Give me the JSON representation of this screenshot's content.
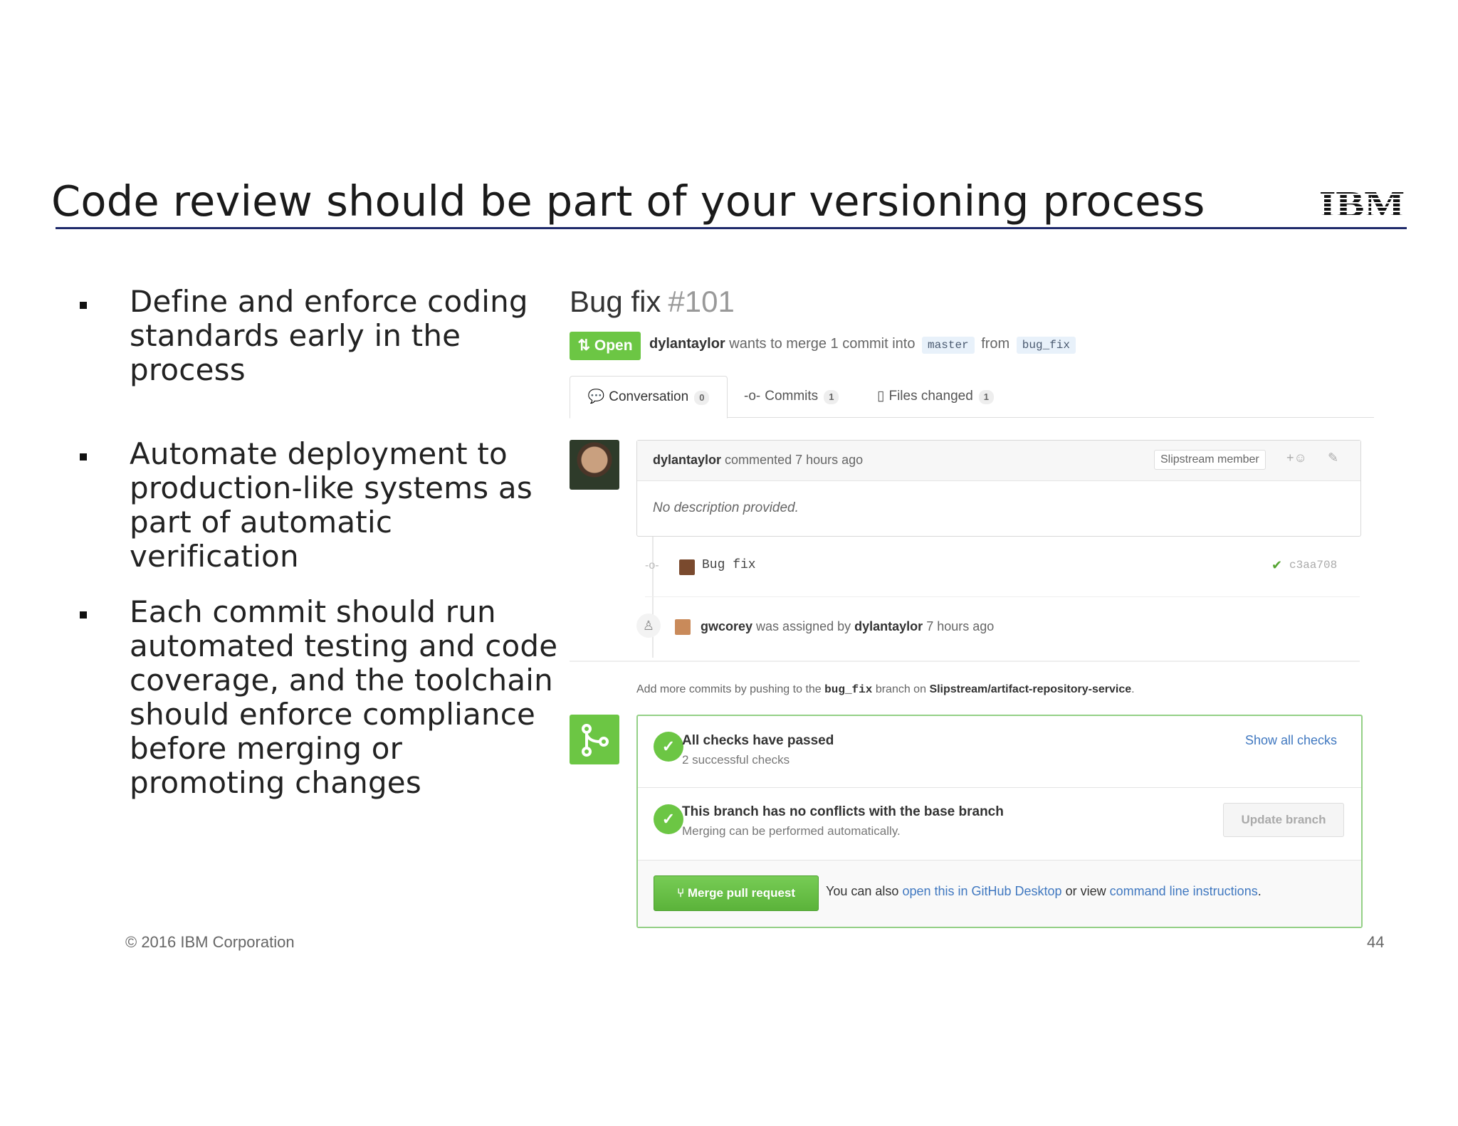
{
  "slide": {
    "title": "Code review should be part of your versioning process",
    "logo_text": "IBM",
    "footer": "© 2016 IBM Corporation",
    "page_number": "44"
  },
  "bullets": [
    "Define and enforce coding standards early in the process",
    "Automate deployment  to production-like  systems  as part of automatic  verification",
    "Each commit should  run automated  testing and code coverage, and the toolchain should  enforce compliance before merging or promoting changes"
  ],
  "pull_request": {
    "title": "Bug fix",
    "number": "#101",
    "state": "Open",
    "author": "dylantaylor",
    "merge_text": "wants to merge 1 commit into",
    "base_branch": "master",
    "from_text": "from",
    "head_branch": "bug_fix",
    "tabs": [
      {
        "label": "Conversation",
        "count": "0",
        "icon": "comment-discussion-icon"
      },
      {
        "label": "Commits",
        "count": "1",
        "icon": "commit-icon"
      },
      {
        "label": "Files changed",
        "count": "1",
        "icon": "file-diff-icon"
      }
    ],
    "comment": {
      "author": "dylantaylor",
      "action": "commented 7 hours ago",
      "badge": "Slipstream member",
      "body": "No description provided."
    },
    "commit": {
      "message": "Bug fix",
      "sha": "c3aa708"
    },
    "assignment": {
      "assignee": "gwcorey",
      "text": "was assigned by",
      "assigner": "dylantaylor",
      "time": "7 hours ago"
    },
    "push_hint": {
      "prefix": "Add more commits by pushing to the",
      "branch": "bug_fix",
      "middle": "branch on",
      "repo": "Slipstream/artifact-repository-service",
      "suffix": "."
    },
    "checks": {
      "title": "All checks have passed",
      "subtitle": "2 successful checks",
      "link": "Show all checks"
    },
    "conflicts": {
      "title": "This branch has no conflicts with the base branch",
      "subtitle": "Merging can be performed automatically.",
      "button": "Update branch"
    },
    "merge": {
      "button": "Merge pull request",
      "note_prefix": "You can also",
      "link1": "open this in GitHub Desktop",
      "note_middle": "or view",
      "link2": "command line instructions",
      "note_suffix": "."
    }
  },
  "colors": {
    "title_rule": "#1f2a6b",
    "open_green": "#6cc644",
    "link_blue": "#4078c0"
  }
}
